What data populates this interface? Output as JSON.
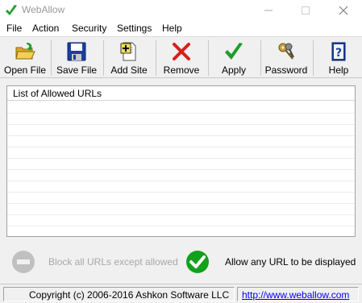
{
  "window": {
    "title": "WebAllow",
    "icon": "green-check-icon",
    "title_color": "#999999"
  },
  "menu": [
    {
      "label": "File"
    },
    {
      "label": "Action"
    },
    {
      "label": "Security"
    },
    {
      "label": "Settings"
    },
    {
      "label": "Help"
    }
  ],
  "toolbar": {
    "open_file": {
      "label": "Open File",
      "icon": "open-folder-icon"
    },
    "save_file": {
      "label": "Save File",
      "icon": "floppy-disk-icon"
    },
    "add_site": {
      "label": "Add Site",
      "icon": "add-page-icon"
    },
    "remove": {
      "label": "Remove",
      "icon": "red-x-icon"
    },
    "apply": {
      "label": "Apply",
      "icon": "green-check-icon"
    },
    "password": {
      "label": "Password",
      "icon": "keys-icon"
    },
    "help": {
      "label": "Help",
      "icon": "question-book-icon"
    }
  },
  "list": {
    "header": "List of Allowed URLs",
    "rows": []
  },
  "mode": {
    "block_label": "Block all URLs except allowed",
    "block_enabled": false,
    "allow_label": "Allow any URL to be displayed",
    "allow_enabled": true,
    "colors": {
      "disabled": "#c0c0c0",
      "active": "#11a11b"
    }
  },
  "status": {
    "copyright": "Copyright (c) 2006-2016 Ashkon Software LLC",
    "url": "http://www.weballow.com"
  }
}
